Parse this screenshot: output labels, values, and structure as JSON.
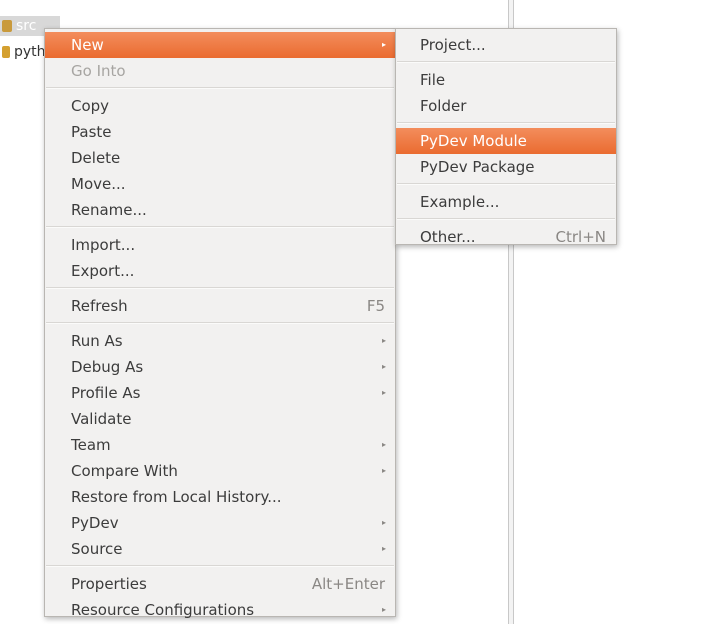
{
  "explorer": {
    "rows": [
      {
        "label": "·····"
      },
      {
        "label": "src"
      },
      {
        "label": "pyth"
      }
    ]
  },
  "context_menu": {
    "items": {
      "new": {
        "label": "New",
        "submenu_arrow": "▸"
      },
      "go_into": {
        "label": "Go Into"
      },
      "copy": {
        "label": "Copy"
      },
      "paste": {
        "label": "Paste"
      },
      "delete": {
        "label": "Delete"
      },
      "move": {
        "label": "Move..."
      },
      "rename": {
        "label": "Rename..."
      },
      "import": {
        "label": "Import..."
      },
      "export": {
        "label": "Export..."
      },
      "refresh": {
        "label": "Refresh",
        "accel": "F5"
      },
      "run_as": {
        "label": "Run As",
        "submenu_arrow": "▸"
      },
      "debug_as": {
        "label": "Debug As",
        "submenu_arrow": "▸"
      },
      "profile_as": {
        "label": "Profile As",
        "submenu_arrow": "▸"
      },
      "validate": {
        "label": "Validate"
      },
      "team": {
        "label": "Team",
        "submenu_arrow": "▸"
      },
      "compare_with": {
        "label": "Compare With",
        "submenu_arrow": "▸"
      },
      "restore": {
        "label": "Restore from Local History..."
      },
      "pydev": {
        "label": "PyDev",
        "submenu_arrow": "▸"
      },
      "source": {
        "label": "Source",
        "submenu_arrow": "▸"
      },
      "properties": {
        "label": "Properties",
        "accel": "Alt+Enter"
      },
      "resource_configurations": {
        "label": "Resource Configurations",
        "submenu_arrow": "▸"
      }
    }
  },
  "new_submenu": {
    "items": {
      "project": {
        "label": "Project..."
      },
      "file": {
        "label": "File"
      },
      "folder": {
        "label": "Folder"
      },
      "pydev_module": {
        "label": "PyDev Module"
      },
      "pydev_package": {
        "label": "PyDev Package"
      },
      "example": {
        "label": "Example..."
      },
      "other": {
        "label": "Other...",
        "accel": "Ctrl+N"
      }
    }
  },
  "colors": {
    "highlight": "#f07746",
    "menu_background": "#f2f1f0",
    "disabled_text": "#a7a5a2"
  }
}
